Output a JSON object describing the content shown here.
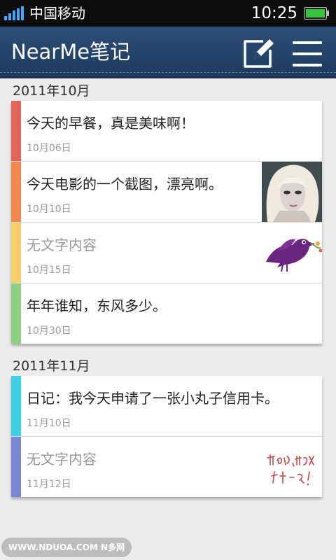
{
  "status_bar": {
    "carrier": "中国移动",
    "time": "10:25",
    "signal_icon": "signal-bars-icon",
    "battery_icon": "battery-full-icon"
  },
  "title_bar": {
    "title": "NearMe笔记",
    "compose_icon": "compose-note-icon",
    "menu_icon": "menu-icon",
    "background_color": "#244469"
  },
  "groups": [
    {
      "month": "2011年10月",
      "notes": [
        {
          "title": "今天的早餐，真是美味啊！",
          "date": "10月06日",
          "color": "#e3645b"
        },
        {
          "title": "今天电影的一个截图，漂亮啊。",
          "date": "10月10日",
          "color": "#f3884a",
          "thumbnail": "portrait-photo"
        },
        {
          "title": "无文字内容",
          "date": "10月15日",
          "color": "#f8cd6a",
          "thumbnail": "purple-bird-drawing"
        },
        {
          "title": "年年谁知，东风多少。",
          "date": "10月30日",
          "color": "#8fd07f"
        }
      ]
    },
    {
      "month": "2011年11月",
      "notes": [
        {
          "title": "日记：我今天申请了一张小丸子信用卡。",
          "date": "11月10日",
          "color": "#3dcfe3"
        },
        {
          "title": "无文字内容",
          "date": "11月12日",
          "color": "#7c86d8",
          "thumbnail": "handwriting-sketch",
          "handwriting": "开心的，快乐的一天！"
        }
      ]
    }
  ],
  "watermark": "WWW.NDUOA.COM N多网"
}
